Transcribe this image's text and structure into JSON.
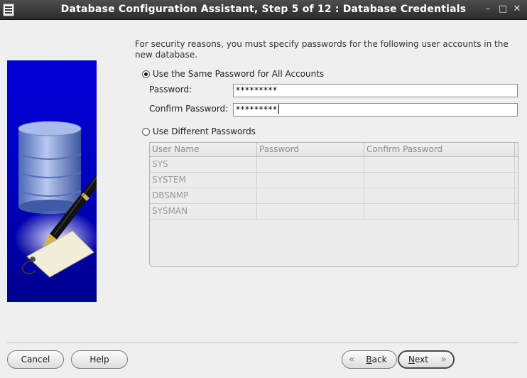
{
  "window": {
    "title": "Database Configuration Assistant, Step 5 of 12 : Database Credentials",
    "minimize_glyph": "–",
    "maximize_glyph": "□",
    "close_glyph": "✕"
  },
  "intro_text": "For security reasons, you must specify passwords for the following user accounts in the new database.",
  "same_password": {
    "radio_label": "Use the Same Password for All Accounts",
    "selected": true,
    "password_label": "Password:",
    "password_value": "*********",
    "confirm_label": "Confirm Password:",
    "confirm_value": "*********"
  },
  "different_passwords": {
    "radio_label": "Use Different Passwords",
    "selected": false,
    "columns": [
      "User Name",
      "Password",
      "Confirm Password"
    ],
    "rows": [
      {
        "user": "SYS",
        "password": "",
        "confirm": ""
      },
      {
        "user": "SYSTEM",
        "password": "",
        "confirm": ""
      },
      {
        "user": "DBSNMP",
        "password": "",
        "confirm": ""
      },
      {
        "user": "SYSMAN",
        "password": "",
        "confirm": ""
      }
    ]
  },
  "buttons": {
    "cancel": "Cancel",
    "help": "Help",
    "back_mnemonic": "B",
    "back_rest": "ack",
    "next_mnemonic": "N",
    "next_rest": "ext"
  },
  "icons": {
    "app": "window-app-icon",
    "side_image": "database-pen-key-illustration"
  },
  "colors": {
    "titlebar": "#2f2f2f",
    "side_panel": "#0000c8",
    "background": "#efefef"
  }
}
